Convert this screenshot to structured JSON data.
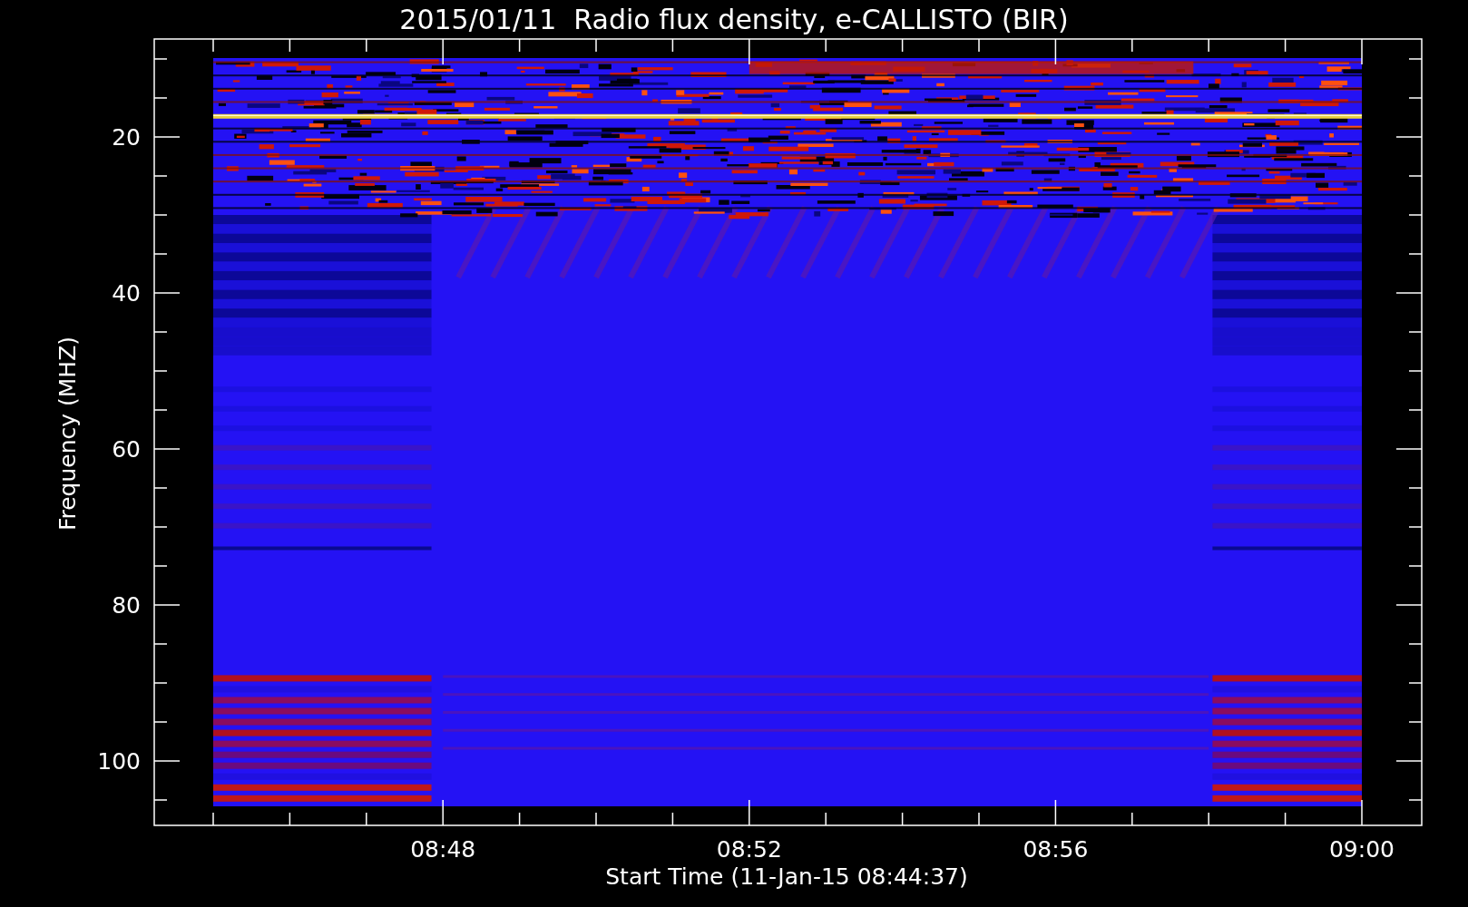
{
  "title": "2015/01/11  Radio flux density, e-CALLISTO (BIR)",
  "y_axis": {
    "label": "Frequency (MHZ)",
    "ticks": [
      "20",
      "40",
      "60",
      "80",
      "100"
    ]
  },
  "x_axis": {
    "label": "Start Time (11-Jan-15 08:44:37)",
    "ticks": [
      "08:48",
      "08:52",
      "08:56",
      "09:00"
    ]
  }
}
